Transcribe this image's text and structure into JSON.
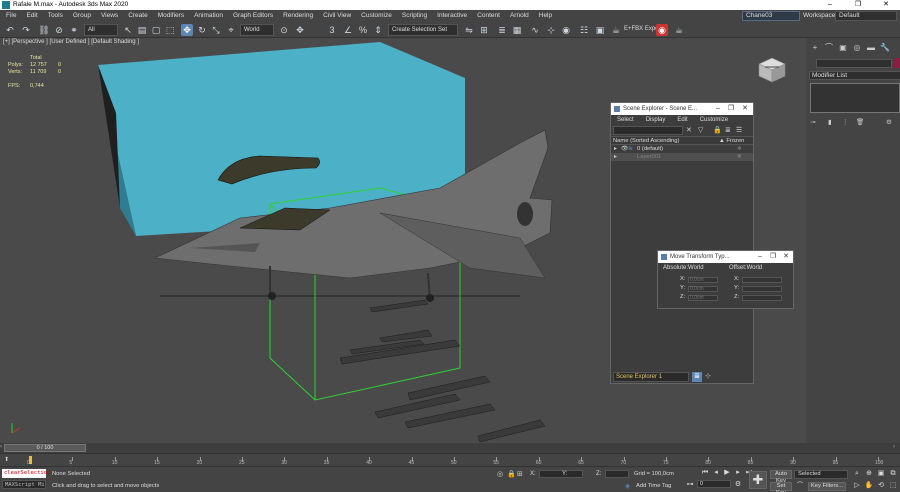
{
  "window": {
    "title": "Rafale M.max - Autodesk 3ds Max 2020",
    "controls": [
      "–",
      "❐",
      "✕"
    ]
  },
  "menubar": {
    "items": [
      "File",
      "Edit",
      "Tools",
      "Group",
      "Views",
      "Create",
      "Modifiers",
      "Animation",
      "Graph Editors",
      "Rendering",
      "Civil View",
      "Customize",
      "Scripting",
      "Interactive",
      "Content",
      "Arnold",
      "Help"
    ],
    "user": "Chane03",
    "workspaces_label": "Workspaces:",
    "workspace": "Default"
  },
  "toolbar": {
    "selection_filter": "All",
    "reference_coord": "World",
    "named_selection": "Create Selection Set",
    "fbx_export": "E+FBX Expor",
    "icons": {
      "undo": "↶",
      "redo": "↷",
      "link": "⛓",
      "unlink": "⊘",
      "bind": "⚭",
      "select": "↖",
      "select_name": "▤",
      "region": "▢",
      "window": "⬚",
      "move": "✥",
      "rotate": "↻",
      "scale": "⤡",
      "place": "⌖",
      "pivot": "⊙",
      "snap": "3",
      "angle": "∠",
      "percent": "%",
      "spinner": "⇕",
      "mirror": "⇋",
      "align": "⊞",
      "layers": "≣",
      "ribbon": "▦",
      "curve": "∿",
      "schematic": "⊹",
      "material": "◉",
      "render_setup": "☷",
      "render_frame": "▣",
      "render": "☕"
    }
  },
  "viewport": {
    "label": "[+] [Perspective ] [User Defined ] [Default Shading ]",
    "stats": {
      "total_label": "Total",
      "polys_label": "Polys:",
      "polys_total": "12 757",
      "polys_sel": "0",
      "verts_label": "Verts:",
      "verts_total": "11 709",
      "verts_sel": "0",
      "fps_label": "FPS:",
      "fps": "0,744"
    },
    "colors": {
      "box": "#4cb0c6",
      "selection_box": "#2fd234",
      "background": "#4a4a4a"
    }
  },
  "command_panel": {
    "tabs": [
      "+",
      "⌒",
      "▣",
      "◎",
      "▬",
      "🔧"
    ],
    "modifier_list": "Modifier List",
    "swatch_color": "#8a1d42"
  },
  "scene_explorer": {
    "title": "Scene Explorer - Scene E...",
    "menu": [
      "Select",
      "Display",
      "Edit",
      "Customize"
    ],
    "col_name": "Name (Sorted Ascending)",
    "col_frozen": "▲ Frozen",
    "rows": [
      {
        "name": "0 (default)"
      },
      {
        "name": "Layer001"
      }
    ],
    "footer_drop": "Scene Explorer 1"
  },
  "move_transform": {
    "title": "Move Transform Typ...",
    "absolute_label": "Absolute:World",
    "offset_label": "Offset:World",
    "abs_x_label": "X:",
    "abs_x": "0,0cm",
    "abs_y_label": "Y:",
    "abs_y": "0,0cm",
    "abs_z_label": "Z:",
    "abs_z": "0,0cm",
    "off_x_label": "X:",
    "off_x": "",
    "off_y_label": "Y:",
    "off_y": "",
    "off_z_label": "Z:",
    "off_z": ""
  },
  "timeline": {
    "frame_display": "0 / 100",
    "ticks": [
      "0",
      "5",
      "10",
      "15",
      "20",
      "25",
      "30",
      "35",
      "40",
      "45",
      "50",
      "55",
      "60",
      "65",
      "70",
      "75",
      "80",
      "85",
      "90",
      "95",
      "100"
    ]
  },
  "statusbar": {
    "maxscript_cmd": "clearSelection",
    "maxscript_placeholder": "MAXScript Mi",
    "selection_status": "None Selected",
    "prompt": "Click and drag to select and move objects",
    "x_label": "X:",
    "y_label": "Y:",
    "z_label": "Z:",
    "grid": "Grid = 100,0cm",
    "add_time_tag": "Add Time Tag",
    "auto_key": "Auto Key",
    "set_key": "Set Key",
    "selected": "Selected",
    "key_filters": "Key Filters...",
    "frame": "0"
  }
}
